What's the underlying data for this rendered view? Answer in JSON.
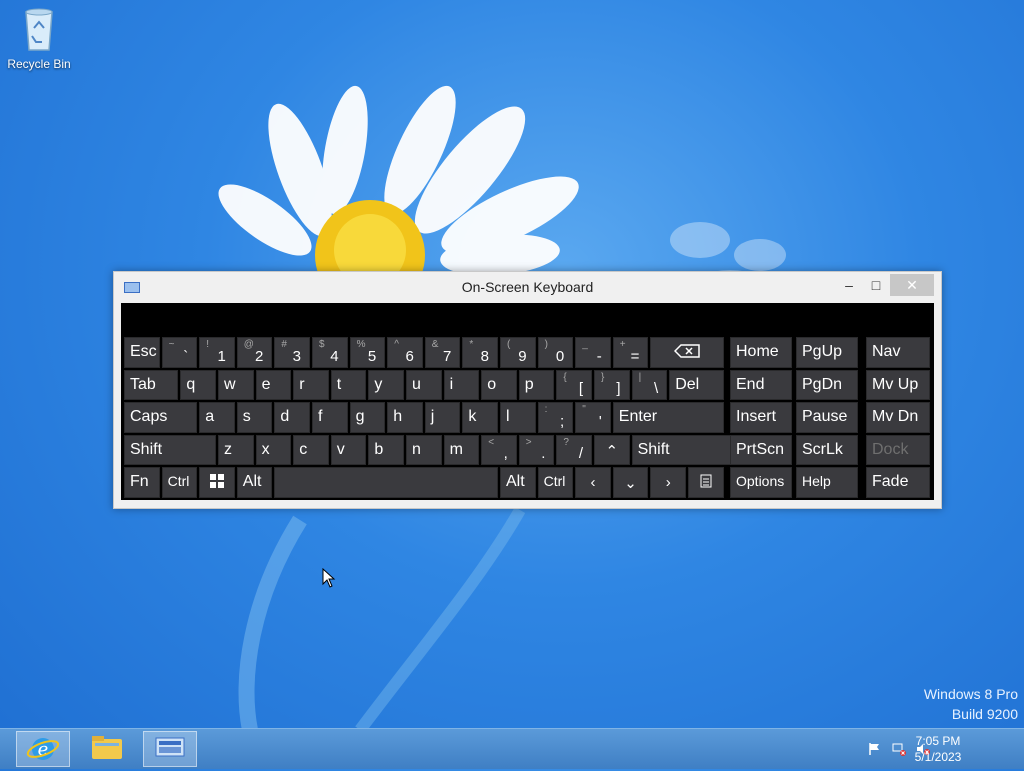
{
  "desktop": {
    "recycle_bin_label": "Recycle Bin",
    "watermark_line1": "Windows 8 Pro",
    "watermark_line2": "Build 9200"
  },
  "osk": {
    "title": "On-Screen Keyboard",
    "controls": {
      "minimize": "–",
      "maximize": "□",
      "close": "✕"
    },
    "rows": [
      [
        {
          "n": "key-esc",
          "l": "Esc",
          "w": 1
        },
        {
          "n": "key-backtick",
          "s": "~",
          "p": "`",
          "w": 1
        },
        {
          "n": "key-1",
          "s": "!",
          "p": "1",
          "w": 1
        },
        {
          "n": "key-2",
          "s": "@",
          "p": "2",
          "w": 1
        },
        {
          "n": "key-3",
          "s": "#",
          "p": "3",
          "w": 1
        },
        {
          "n": "key-4",
          "s": "$",
          "p": "4",
          "w": 1
        },
        {
          "n": "key-5",
          "s": "%",
          "p": "5",
          "w": 1
        },
        {
          "n": "key-6",
          "s": "^",
          "p": "6",
          "w": 1
        },
        {
          "n": "key-7",
          "s": "&",
          "p": "7",
          "w": 1
        },
        {
          "n": "key-8",
          "s": "*",
          "p": "8",
          "w": 1
        },
        {
          "n": "key-9",
          "s": "(",
          "p": "9",
          "w": 1
        },
        {
          "n": "key-0",
          "s": ")",
          "p": "0",
          "w": 1
        },
        {
          "n": "key-minus",
          "s": "_",
          "p": "-",
          "w": 1
        },
        {
          "n": "key-equals",
          "s": "+",
          "p": "=",
          "w": 1
        },
        {
          "n": "key-backspace",
          "icon": "backspace-icon",
          "w": 2
        }
      ],
      [
        {
          "n": "key-tab",
          "l": "Tab",
          "w": 1.5
        },
        {
          "n": "key-q",
          "l": "q",
          "w": 1
        },
        {
          "n": "key-w",
          "l": "w",
          "w": 1
        },
        {
          "n": "key-e",
          "l": "e",
          "w": 1
        },
        {
          "n": "key-r",
          "l": "r",
          "w": 1
        },
        {
          "n": "key-t",
          "l": "t",
          "w": 1
        },
        {
          "n": "key-y",
          "l": "y",
          "w": 1
        },
        {
          "n": "key-u",
          "l": "u",
          "w": 1
        },
        {
          "n": "key-i",
          "l": "i",
          "w": 1
        },
        {
          "n": "key-o",
          "l": "o",
          "w": 1
        },
        {
          "n": "key-p",
          "l": "p",
          "w": 1
        },
        {
          "n": "key-lbracket",
          "s": "{",
          "p": "[",
          "w": 1
        },
        {
          "n": "key-rbracket",
          "s": "}",
          "p": "]",
          "w": 1
        },
        {
          "n": "key-backslash",
          "s": "|",
          "p": "\\",
          "w": 1
        },
        {
          "n": "key-del",
          "l": "Del",
          "w": 1.5
        }
      ],
      [
        {
          "n": "key-caps",
          "l": "Caps",
          "w": 2
        },
        {
          "n": "key-a",
          "l": "a",
          "w": 1
        },
        {
          "n": "key-s",
          "l": "s",
          "w": 1
        },
        {
          "n": "key-d",
          "l": "d",
          "w": 1
        },
        {
          "n": "key-f",
          "l": "f",
          "w": 1
        },
        {
          "n": "key-g",
          "l": "g",
          "w": 1
        },
        {
          "n": "key-h",
          "l": "h",
          "w": 1
        },
        {
          "n": "key-j",
          "l": "j",
          "w": 1
        },
        {
          "n": "key-k",
          "l": "k",
          "w": 1
        },
        {
          "n": "key-l",
          "l": "l",
          "w": 1
        },
        {
          "n": "key-semicolon",
          "s": ":",
          "p": ";",
          "w": 1
        },
        {
          "n": "key-quote",
          "s": "\"",
          "p": "'",
          "w": 1
        },
        {
          "n": "key-enter",
          "l": "Enter",
          "w": 3
        }
      ],
      [
        {
          "n": "key-shift-left",
          "l": "Shift",
          "w": 2.5
        },
        {
          "n": "key-z",
          "l": "z",
          "w": 1
        },
        {
          "n": "key-x",
          "l": "x",
          "w": 1
        },
        {
          "n": "key-c",
          "l": "c",
          "w": 1
        },
        {
          "n": "key-v",
          "l": "v",
          "w": 1
        },
        {
          "n": "key-b",
          "l": "b",
          "w": 1
        },
        {
          "n": "key-n",
          "l": "n",
          "w": 1
        },
        {
          "n": "key-m",
          "l": "m",
          "w": 1
        },
        {
          "n": "key-comma",
          "s": "<",
          "p": ",",
          "w": 1
        },
        {
          "n": "key-period",
          "s": ">",
          "p": ".",
          "w": 1
        },
        {
          "n": "key-slash",
          "s": "?",
          "p": "/",
          "w": 1
        },
        {
          "n": "key-up",
          "glyph": "⌃",
          "w": 1
        },
        {
          "n": "key-shift-right",
          "l": "Shift",
          "w": 3
        }
      ],
      [
        {
          "n": "key-fn",
          "l": "Fn",
          "w": 1
        },
        {
          "n": "key-ctrl-left",
          "l": "Ctrl",
          "w": 1,
          "small": true
        },
        {
          "n": "key-win",
          "icon": "windows-logo-icon",
          "w": 1
        },
        {
          "n": "key-alt-left",
          "l": "Alt",
          "w": 1
        },
        {
          "n": "key-space",
          "l": "",
          "w": 6
        },
        {
          "n": "key-alt-right",
          "l": "Alt",
          "w": 1
        },
        {
          "n": "key-ctrl-right",
          "l": "Ctrl",
          "w": 1,
          "small": true
        },
        {
          "n": "key-left",
          "glyph": "‹",
          "w": 1
        },
        {
          "n": "key-down",
          "glyph": "⌄",
          "w": 1
        },
        {
          "n": "key-right",
          "glyph": "›",
          "w": 1
        },
        {
          "n": "key-menu",
          "icon": "menu-key-icon",
          "w": 1
        }
      ]
    ],
    "nav_rows": [
      [
        {
          "n": "key-home",
          "l": "Home"
        },
        {
          "n": "key-pgup",
          "l": "PgUp"
        },
        {
          "n": "key-nav",
          "l": "Nav"
        }
      ],
      [
        {
          "n": "key-end",
          "l": "End"
        },
        {
          "n": "key-pgdn",
          "l": "PgDn"
        },
        {
          "n": "key-mvup",
          "l": "Mv Up"
        }
      ],
      [
        {
          "n": "key-insert",
          "l": "Insert"
        },
        {
          "n": "key-pause",
          "l": "Pause"
        },
        {
          "n": "key-mvdn",
          "l": "Mv Dn"
        }
      ],
      [
        {
          "n": "key-prtscn",
          "l": "PrtScn"
        },
        {
          "n": "key-scrlk",
          "l": "ScrLk"
        },
        {
          "n": "key-dock",
          "l": "Dock",
          "disabled": true
        }
      ],
      [
        {
          "n": "key-options",
          "l": "Options",
          "small": true
        },
        {
          "n": "key-help",
          "l": "Help",
          "small": true
        },
        {
          "n": "key-fade",
          "l": "Fade"
        }
      ]
    ]
  },
  "taskbar": {
    "clock_time": "7:05 PM",
    "clock_date": "5/1/2023",
    "colors": {
      "bar": "#3f7fc4",
      "active": "#ffffff"
    }
  }
}
